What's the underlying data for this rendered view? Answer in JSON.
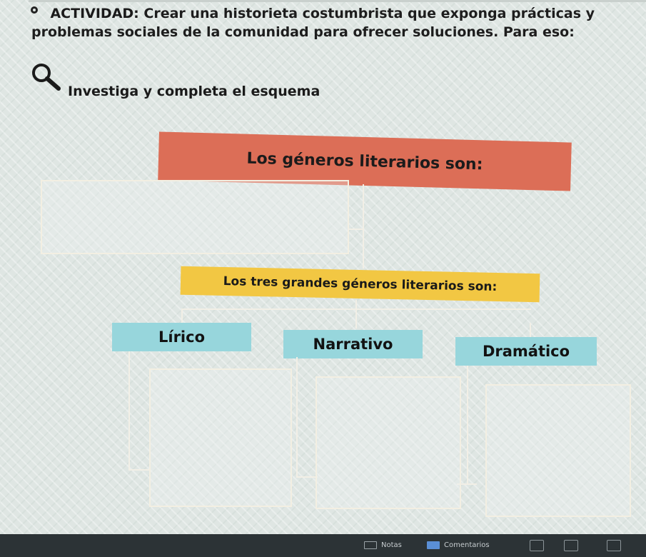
{
  "activity": {
    "label": "ACTIVIDAD:",
    "text": "Crear una historieta costumbrista que exponga prácticas y problemas sociales de la comunidad para ofrecer soluciones. Para eso:"
  },
  "instruction": "Investiga y completa el esquema",
  "schema": {
    "main_title": "Los géneros literarios son:",
    "sub_title": "Los tres grandes géneros literarios son:",
    "genres": [
      "Lírico",
      "Narrativo",
      "Dramático"
    ]
  },
  "bottombar": {
    "notes": "Notas",
    "comments": "Comentarios"
  },
  "colors": {
    "banner_main": "#dc6e57",
    "banner_yellow": "#f2c743",
    "genre_box": "#97d6dc"
  }
}
